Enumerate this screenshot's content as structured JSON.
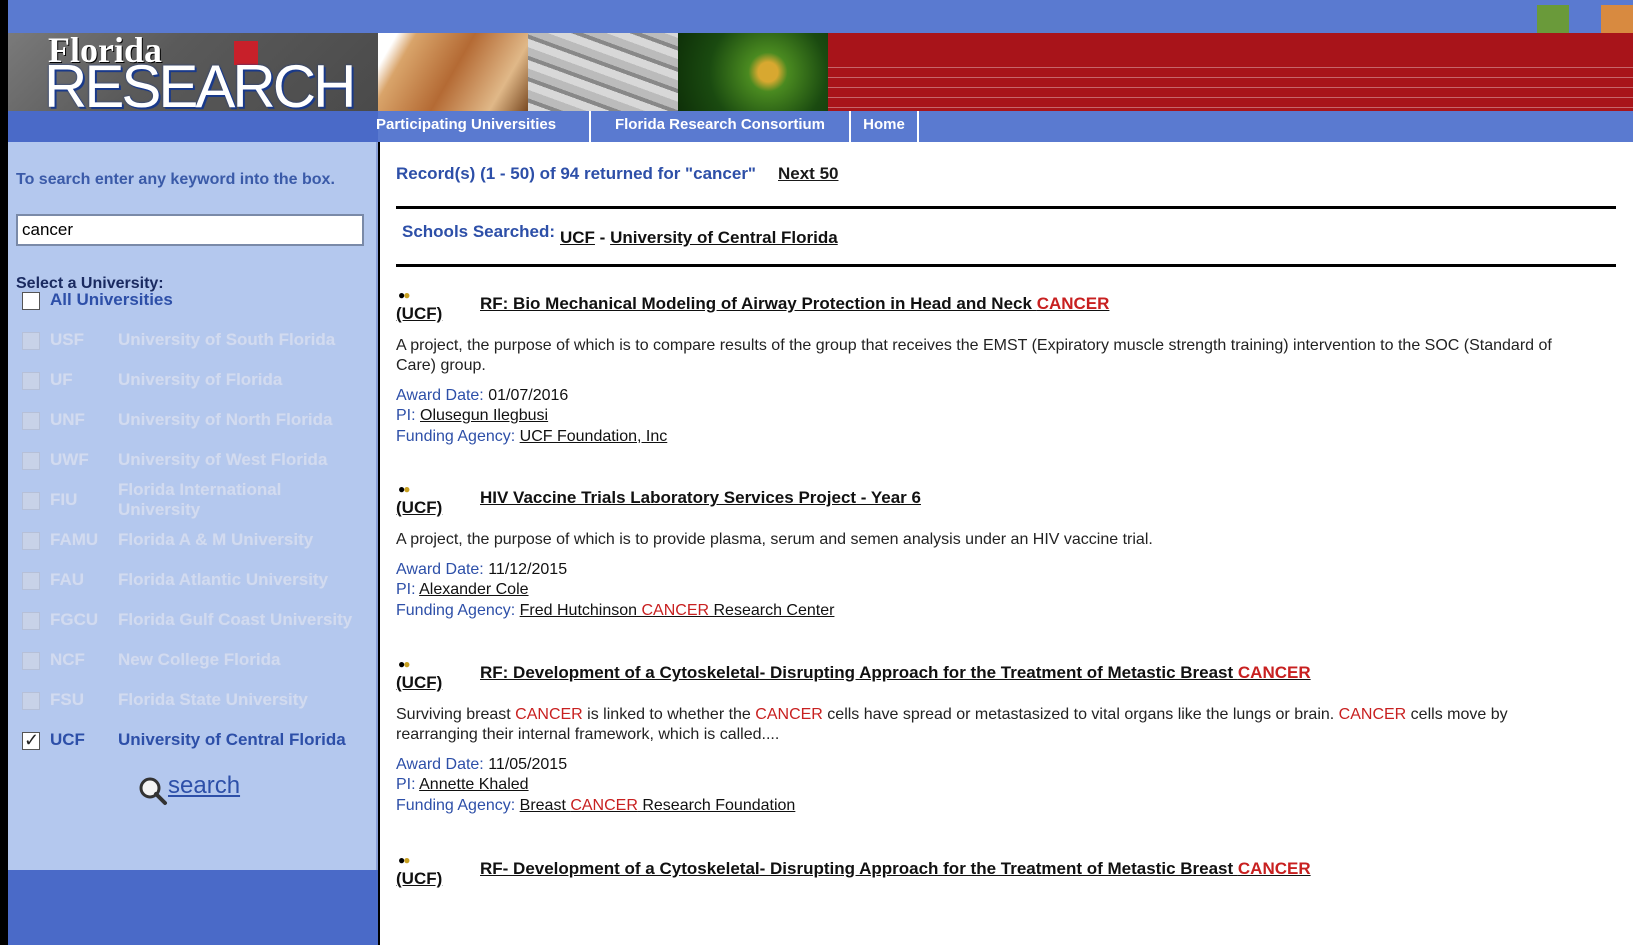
{
  "brand": {
    "top_line": "Florida",
    "main_line": "RESEARCH"
  },
  "top_colors": [
    "#6a9a3a",
    "#5a7ad0",
    "#d88a40"
  ],
  "nav": {
    "items": [
      "Participating Universities",
      "Florida Research Consortium",
      "Home"
    ]
  },
  "sidebar": {
    "hint": "To search enter any keyword into the box.",
    "search_value": "cancer",
    "select_label": "Select a University:",
    "all_label": "All Universities",
    "universities": [
      {
        "abbr": "USF",
        "name": "University of South Florida",
        "enabled": false,
        "checked": false
      },
      {
        "abbr": "UF",
        "name": "University of Florida",
        "enabled": false,
        "checked": false
      },
      {
        "abbr": "UNF",
        "name": "University of North Florida",
        "enabled": false,
        "checked": false
      },
      {
        "abbr": "UWF",
        "name": "University of West Florida",
        "enabled": false,
        "checked": false
      },
      {
        "abbr": "FIU",
        "name": "Florida International University",
        "enabled": false,
        "checked": false
      },
      {
        "abbr": "FAMU",
        "name": "Florida A & M University",
        "enabled": false,
        "checked": false
      },
      {
        "abbr": "FAU",
        "name": "Florida Atlantic University",
        "enabled": false,
        "checked": false
      },
      {
        "abbr": "FGCU",
        "name": "Florida Gulf Coast University",
        "enabled": false,
        "checked": false
      },
      {
        "abbr": "NCF",
        "name": "New College Florida",
        "enabled": false,
        "checked": false
      },
      {
        "abbr": "FSU",
        "name": "Florida State University",
        "enabled": false,
        "checked": false
      },
      {
        "abbr": "UCF",
        "name": "University of Central Florida",
        "enabled": true,
        "checked": true
      }
    ],
    "search_button": "search"
  },
  "main": {
    "records_text": "Record(s) (1 - 50) of 94 returned for \"cancer\"",
    "next_label": "Next 50",
    "schools_label": "Schools Searched:",
    "school_abbr": "UCF",
    "school_sep": " - ",
    "school_name": "University of Central Florida",
    "results": [
      {
        "tag": "(UCF)",
        "title": [
          [
            "RF: Bio Mechanical Modeling of Airway Protection in Head and Neck ",
            false
          ],
          [
            "CANCER",
            true
          ]
        ],
        "desc": [
          [
            "A project, the purpose of which is to compare results of the group that receives the EMST (Expiratory muscle strength training) intervention to the SOC (Standard of Care) group.",
            false
          ]
        ],
        "award_label": "Award Date:",
        "award": "01/07/2016",
        "pi_label": "PI:",
        "pi": "Olusegun Ilegbusi",
        "agency_label": "Funding Agency:",
        "agency": [
          [
            "UCF Foundation, Inc",
            false
          ]
        ]
      },
      {
        "tag": "(UCF)",
        "title": [
          [
            "HIV Vaccine Trials Laboratory Services Project - Year 6",
            false
          ]
        ],
        "desc": [
          [
            "A project, the purpose of which is to provide plasma, serum and semen analysis under an HIV vaccine trial.",
            false
          ]
        ],
        "award_label": "Award Date:",
        "award": "11/12/2015",
        "pi_label": "PI:",
        "pi": "Alexander Cole",
        "agency_label": "Funding Agency:",
        "agency": [
          [
            "Fred Hutchinson ",
            false
          ],
          [
            "CANCER",
            true
          ],
          [
            " Research Center",
            false
          ]
        ]
      },
      {
        "tag": "(UCF)",
        "title": [
          [
            "RF: Development of a Cytoskeletal- Disrupting Approach for the Treatment of Metastic Breast ",
            false
          ],
          [
            "CANCER",
            true
          ]
        ],
        "desc": [
          [
            "Surviving breast ",
            false
          ],
          [
            "CANCER",
            true
          ],
          [
            " is linked to whether the ",
            false
          ],
          [
            "CANCER",
            true
          ],
          [
            " cells have spread or metastasized to vital organs like the lungs or brain. ",
            false
          ],
          [
            "CANCER",
            true
          ],
          [
            " cells move by rearranging their internal framework, which is called....",
            false
          ]
        ],
        "award_label": "Award Date:",
        "award": "11/05/2015",
        "pi_label": "PI:",
        "pi": "Annette Khaled",
        "agency_label": "Funding Agency:",
        "agency": [
          [
            "Breast ",
            false
          ],
          [
            "CANCER",
            true
          ],
          [
            " Research Foundation",
            false
          ]
        ]
      },
      {
        "tag": "(UCF)",
        "title": [
          [
            "RF- Development of a Cytoskeletal- Disrupting Approach for the Treatment of Metastic Breast ",
            false
          ],
          [
            "CANCER",
            true
          ]
        ]
      }
    ]
  }
}
